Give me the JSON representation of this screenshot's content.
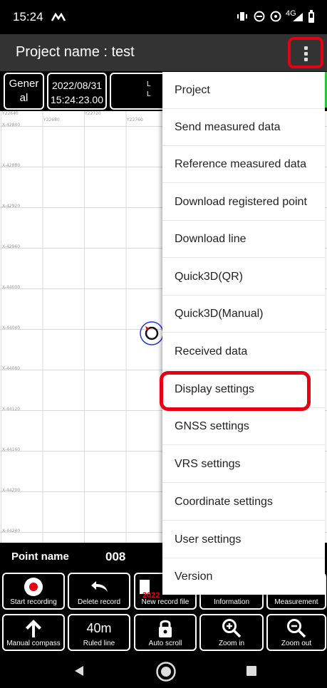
{
  "status_bar": {
    "time": "15:24",
    "network": "4G"
  },
  "app_bar": {
    "title": "Project name : test"
  },
  "info": {
    "mode": "Gener al",
    "date": "2022/08/31",
    "time": "15:24:23.00",
    "line_1": "L",
    "line_2": "L"
  },
  "grid": {
    "x_labels": [
      "Y22640",
      "Y22680",
      "Y22720",
      "Y22760"
    ],
    "y_labels": [
      "X-42840",
      "X-42880",
      "X-42920",
      "X-42960",
      "X-44000",
      "X-44040",
      "X-44080",
      "X-44120",
      "X-44160",
      "X-44200",
      "X-44240"
    ]
  },
  "point": {
    "label": "Point name",
    "value": "008"
  },
  "row1": [
    {
      "label": "Start recording",
      "icon": "record-icon"
    },
    {
      "label": "Delete record",
      "icon": "undo-icon"
    },
    {
      "label": "New record file",
      "icon": "file-icon",
      "overlay": "2022"
    },
    {
      "label": "Information",
      "icon": "info-icon"
    },
    {
      "label": "Measurement",
      "icon": "measurement-icon"
    }
  ],
  "row2": [
    {
      "label": "Manual compass",
      "icon": "arrow-up-icon"
    },
    {
      "label": "Ruled line",
      "value": "40m"
    },
    {
      "label": "Auto scroll",
      "icon": "lock-icon"
    },
    {
      "label": "Zoom in",
      "icon": "zoom-in-icon"
    },
    {
      "label": "Zoom out",
      "icon": "zoom-out-icon"
    }
  ],
  "menu": {
    "items": [
      "Project",
      "Send measured data",
      "Reference measured data",
      "Download registered point",
      "Download line",
      "Quick3D(QR)",
      "Quick3D(Manual)",
      "Received data",
      "Display settings",
      "GNSS settings",
      "VRS settings",
      "Coordinate settings",
      "User settings",
      "Version"
    ]
  },
  "colors": {
    "highlight": "#e50012",
    "appbar": "#333333",
    "accent_green": "#2ecc40"
  }
}
